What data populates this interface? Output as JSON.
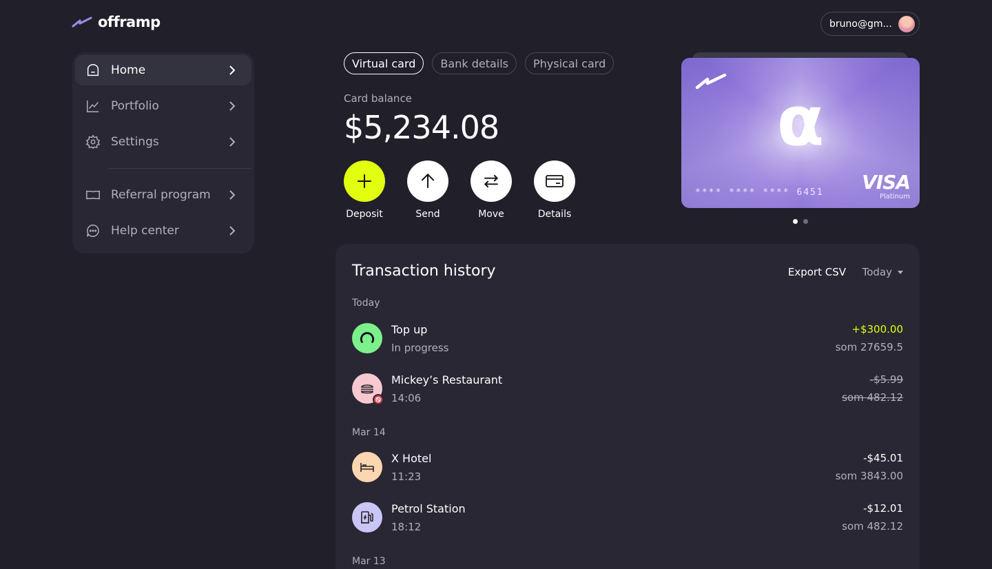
{
  "header": {
    "brand": "offramp",
    "account_email": "bruno@gm..."
  },
  "sidebar": {
    "items": [
      {
        "label": "Home",
        "icon": "home-icon",
        "active": true
      },
      {
        "label": "Portfolio",
        "icon": "chart-line-icon"
      },
      {
        "label": "Settings",
        "icon": "gear-icon"
      },
      {
        "label": "Referral program",
        "icon": "ticket-icon"
      },
      {
        "label": "Help center",
        "icon": "chat-bubble-icon"
      }
    ]
  },
  "tabs": [
    {
      "label": "Virtual card",
      "active": true
    },
    {
      "label": "Bank details"
    },
    {
      "label": "Physical card"
    }
  ],
  "balance": {
    "label": "Card balance",
    "value": "$5,234.08"
  },
  "actions": [
    {
      "label": "Deposit",
      "icon": "plus-icon"
    },
    {
      "label": "Send",
      "icon": "arrow-up-icon"
    },
    {
      "label": "Move",
      "icon": "swap-arrows-icon"
    },
    {
      "label": "Details",
      "icon": "card-icon"
    }
  ],
  "card": {
    "symbol": "α",
    "number": "**** **** **** 6451",
    "network": "VISA",
    "tier": "Platinum",
    "pagination": {
      "current": 1,
      "total": 2
    }
  },
  "transactions": {
    "title": "Transaction history",
    "export_label": "Export CSV",
    "filter_label": "Today",
    "groups": [
      {
        "label": "Today",
        "items": [
          {
            "name": "Top up",
            "sub": "In progress",
            "amount": "+$300.00",
            "local": "som 27659.5",
            "icon": "spinner-icon",
            "color": "#7cf08a"
          },
          {
            "name": "Mickey’s Restaurant",
            "sub": "14:06",
            "amount": "-$5.99",
            "local": "som 482.12",
            "icon": "burger-icon",
            "color": "#f6c8cf",
            "declined": true
          }
        ]
      },
      {
        "label": "Mar 14",
        "items": [
          {
            "name": "X Hotel",
            "sub": "11:23",
            "amount": "-$45.01",
            "local": "som 3843.00",
            "icon": "bed-icon",
            "color": "#fbd6b0"
          },
          {
            "name": "Petrol Station",
            "sub": "18:12",
            "amount": "-$12.01",
            "local": "som 482.12",
            "icon": "fuel-pump-icon",
            "color": "#c9c6f6"
          }
        ]
      },
      {
        "label": "Mar 13",
        "items": []
      }
    ]
  },
  "colors": {
    "background": "#201f2a",
    "panel": "#282733",
    "accent": "#e2ff0f",
    "card_purple": "#8a73d6"
  }
}
